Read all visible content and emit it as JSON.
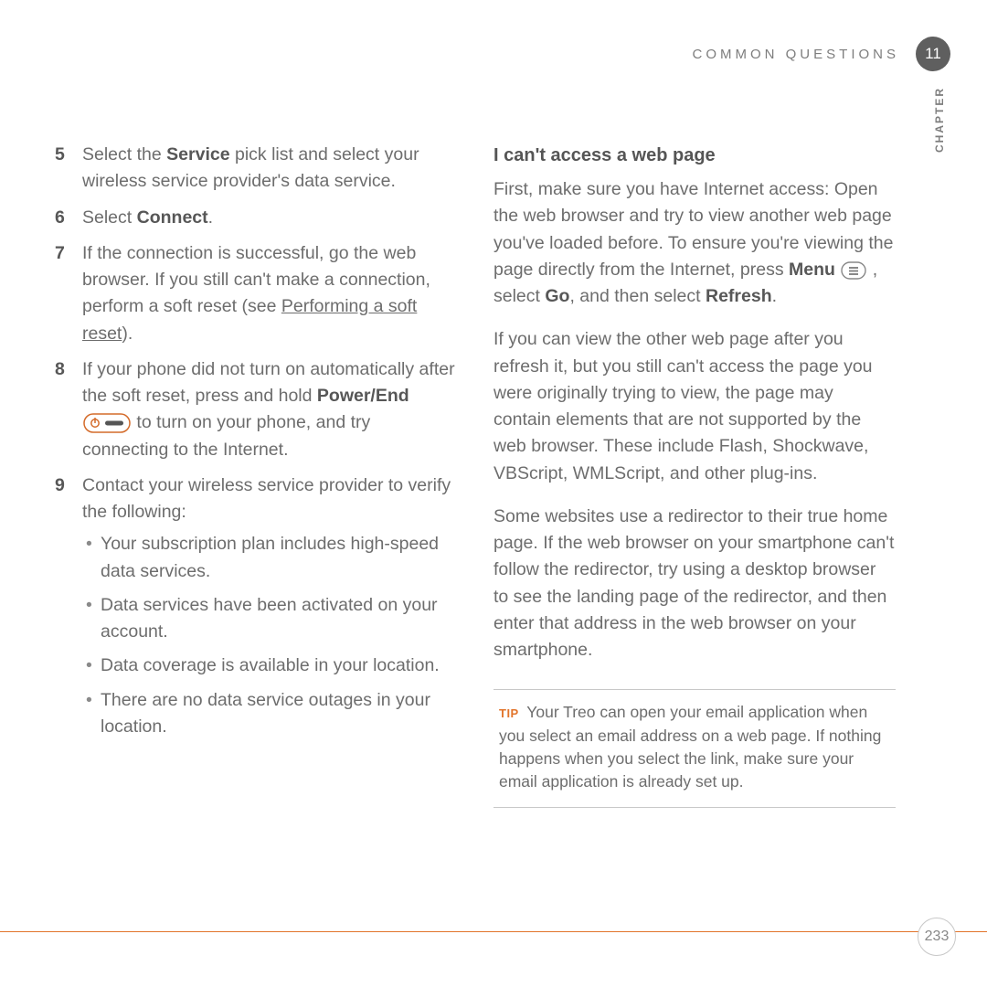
{
  "header": {
    "title": "COMMON QUESTIONS",
    "chapter_number": "11",
    "chapter_label": "CHAPTER"
  },
  "left": {
    "item5": {
      "num": "5",
      "t1": "Select the",
      "bold": "Service",
      "t2": "pick list and select your wireless service provider's data service."
    },
    "item6": {
      "num": "6",
      "t1": "Select",
      "bold": "Connect",
      "t2": "."
    },
    "item7": {
      "num": "7",
      "t1": "If the connection is successful, go the web browser. If you still can't make a connection, perform a soft reset (see",
      "link": "Performing a soft reset",
      "t2": ")."
    },
    "item8": {
      "num": "8",
      "t1": "If your phone did not turn on automatically after the soft reset, press and hold",
      "bold": "Power/End",
      "t2": "to turn on your phone, and try connecting to the Internet."
    },
    "item9": {
      "num": "9",
      "t1": "Contact your wireless service provider to verify the following:",
      "sub": {
        "a": "Your subscription plan includes high-speed data services.",
        "b": "Data services have been activated on your account.",
        "c": "Data coverage is available in your location.",
        "d": "There are no data service outages in your location."
      }
    }
  },
  "right": {
    "heading": "I can't access a web page",
    "p1_a": "First, make sure you have Internet access: Open the web browser and try to view another web page you've loaded before. To ensure you're viewing the page directly from the Internet, press",
    "p1_bold1": "Menu",
    "p1_b": ", select",
    "p1_bold2": "Go",
    "p1_c": ", and then select",
    "p1_bold3": "Refresh",
    "p1_d": ".",
    "p2": "If you can view the other web page after you refresh it, but you still can't access the page you were originally trying to view, the page may contain elements that are not supported by the web browser. These include Flash, Shockwave, VBScript, WMLScript, and other plug-ins.",
    "p3": "Some websites use a redirector to their true home page. If the web browser on your smartphone can't follow the redirector, try using a desktop browser to see the landing page of the redirector, and then enter that address in the web browser on your smartphone.",
    "tip_label": "TIP",
    "tip_text": "Your Treo can open your email application when you select an email address on a web page. If nothing happens when you select the link, make sure your email application is already set up."
  },
  "footer": {
    "page_number": "233"
  }
}
